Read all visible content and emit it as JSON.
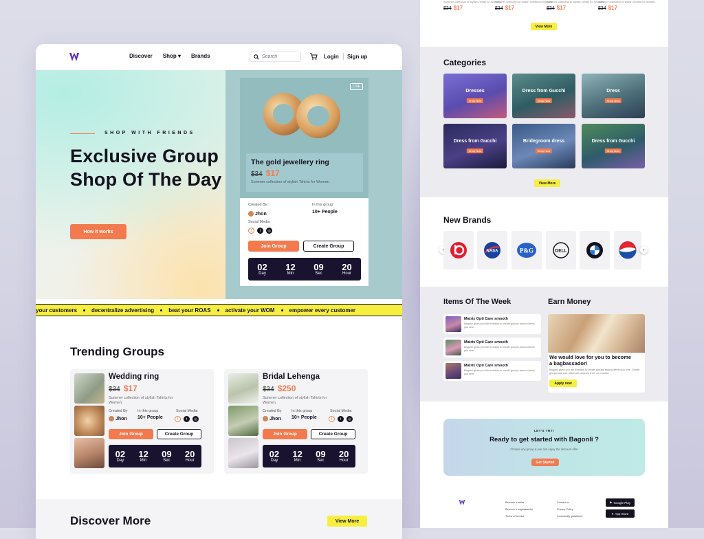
{
  "nav": {
    "links": [
      "Discover",
      "Shop",
      "Brands"
    ],
    "search_placeholder": "Search",
    "login": "Login",
    "signup": "Sign up"
  },
  "hero": {
    "eyebrow": "SHOP WITH FRIENDS",
    "title": "Exclusive Group Shop Of The Day",
    "cta": "How it works"
  },
  "featured": {
    "badge": "LIVE",
    "name": "The gold jewellery ring",
    "old_price": "$34",
    "new_price": "$17",
    "description": "Summer collection of stylish Tshirts for Women.",
    "created_by_label": "Created By",
    "creator": "Jhon",
    "group_label": "In this group",
    "group_count": "10+ People",
    "social_label": "Social Media",
    "join_label": "Join Group",
    "create_label": "Create Group",
    "countdown": [
      {
        "value": "02",
        "unit": "Day"
      },
      {
        "value": "12",
        "unit": "Min"
      },
      {
        "value": "09",
        "unit": "Sec"
      },
      {
        "value": "20",
        "unit": "Hour"
      }
    ]
  },
  "ticker": [
    "your customers",
    "decentralize advertising",
    "beat your ROAS",
    "activate your WOM",
    "empower every customer"
  ],
  "trending": {
    "title": "Trending Groups",
    "cards": [
      {
        "name": "Wedding ring",
        "old_price": "$34",
        "new_price": "$17",
        "description": "Summer collection of stylish Tshirts for Women.",
        "created_by_label": "Created By",
        "creator": "Jhon",
        "group_label": "In this group",
        "group_count": "10+ People",
        "social_label": "Social Media",
        "join_label": "Join Group",
        "create_label": "Create Group",
        "countdown": [
          {
            "value": "02",
            "unit": "Day"
          },
          {
            "value": "12",
            "unit": "Min"
          },
          {
            "value": "09",
            "unit": "Sec"
          },
          {
            "value": "20",
            "unit": "Hour"
          }
        ]
      },
      {
        "name": "Bridal Lehenga",
        "old_price": "$34",
        "new_price": "$250",
        "description": "Summer collection of stylish Tshirts for Women.",
        "created_by_label": "Created By",
        "creator": "Jhon",
        "group_label": "In this group",
        "group_count": "10+ People",
        "social_label": "Social Media",
        "join_label": "Join Group",
        "create_label": "Create Group",
        "countdown": [
          {
            "value": "02",
            "unit": "Day"
          },
          {
            "value": "12",
            "unit": "Min"
          },
          {
            "value": "09",
            "unit": "Sec"
          },
          {
            "value": "20",
            "unit": "Hour"
          }
        ]
      }
    ]
  },
  "discover": {
    "title": "Discover More",
    "view_more": "View More"
  },
  "right": {
    "top_items": [
      {
        "desc": "Summer collection of stylish Tshirts for Women.",
        "old_price": "$34",
        "new_price": "$17"
      },
      {
        "desc": "Summer collection of stylish Tshirts for Women.",
        "old_price": "$34",
        "new_price": "$17"
      },
      {
        "desc": "Summer collection of stylish Tshirts for Women.",
        "old_price": "$34",
        "new_price": "$17"
      },
      {
        "desc": "Summer collection of stylish Tshirts for Women.",
        "old_price": "$34",
        "new_price": "$17"
      }
    ],
    "top_view_more": "View More",
    "categories": {
      "title": "Categories",
      "shop_now": "Shop Now",
      "tiles": [
        "Dresses",
        "Dress from Gucchi",
        "Dress",
        "Dress from Gucchi",
        "Bridegroom dress",
        "Dress from Gucchi"
      ],
      "view_more": "View More"
    },
    "brands": {
      "title": "New Brands",
      "logos": [
        "beats",
        "NASA",
        "P&G",
        "DELL",
        "BMW",
        "Pepsi"
      ]
    },
    "week": {
      "title": "Items Of The Week",
      "items": [
        {
          "name": "Matrix Opti Care smooth",
          "desc": "Bagonli gives you the freedom to create groups around items you love."
        },
        {
          "name": "Matrix Opti Care smooth",
          "desc": "Bagonli gives you the freedom to create groups around items you love."
        },
        {
          "name": "Matrix Opti Care smooth",
          "desc": "Bagonli gives you the freedom to create groups around items you love."
        }
      ]
    },
    "earn": {
      "title": "Earn Money",
      "headline": "We would love for you to become a bagbassador!",
      "desc": "Bagonli gives you the freedom to create groups around items you love. Create groups and earn discount coupons from our brands.",
      "apply": "Apply now"
    },
    "cta": {
      "eyebrow": "LET'S TRY!",
      "title": "Ready to get started with Bagonli ?",
      "desc": "Choose any group & join and enjoy the discount offer",
      "button": "Get Started"
    },
    "footer": {
      "col1": [
        "Become a seller",
        "Become a bagbassador",
        "Terms of service"
      ],
      "col2": [
        "Contact us",
        "Privacy Policy",
        "Community guidelines"
      ],
      "stores": [
        "Google Play",
        "App Store"
      ]
    }
  },
  "colors": {
    "accent": "#f37a4e",
    "dark": "#1a1330",
    "highlight": "#f6ef3f",
    "teal": "#a7cbcd"
  }
}
